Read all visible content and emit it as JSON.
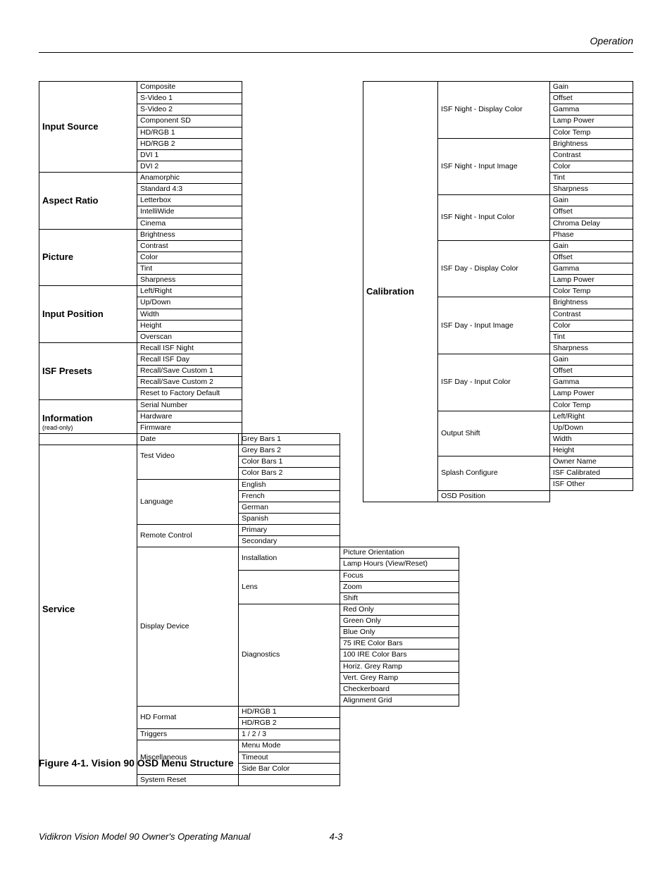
{
  "header": {
    "section": "Operation"
  },
  "left_table": {
    "groups": [
      {
        "title": "Input Source",
        "sub": "",
        "items": [
          "Composite",
          "S-Video 1",
          "S-Video 2",
          "Component SD",
          "HD/RGB 1",
          "HD/RGB 2",
          "DVI 1",
          "DVI 2"
        ]
      },
      {
        "title": "Aspect Ratio",
        "sub": "",
        "items": [
          "Anamorphic",
          "Standard 4:3",
          "Letterbox",
          "IntelliWide",
          "Cinema"
        ]
      },
      {
        "title": "Picture",
        "sub": "",
        "items": [
          "Brightness",
          "Contrast",
          "Color",
          "Tint",
          "Sharpness"
        ]
      },
      {
        "title": "Input Position",
        "sub": "",
        "items": [
          "Left/Right",
          "Up/Down",
          "Width",
          "Height",
          "Overscan"
        ]
      },
      {
        "title": "ISF Presets",
        "sub": "",
        "items": [
          "Recall ISF Night",
          "Recall ISF Day",
          "Recall/Save Custom 1",
          "Recall/Save Custom 2",
          "Reset to Factory Default"
        ]
      },
      {
        "title": "Information",
        "sub": "(read-only)",
        "items": [
          "Serial Number",
          "Hardware",
          "Firmware",
          "Date"
        ]
      }
    ]
  },
  "service_table": {
    "title": "Service",
    "rows": [
      {
        "c2": "Test Video",
        "c2span": 4,
        "c3": "Grey Bars 1"
      },
      {
        "c3": "Grey Bars 2"
      },
      {
        "c3": "Color Bars 1"
      },
      {
        "c3": "Color Bars 2"
      },
      {
        "c2": "Language",
        "c2span": 4,
        "c3": "English"
      },
      {
        "c3": "French"
      },
      {
        "c3": "German"
      },
      {
        "c3": "Spanish"
      },
      {
        "c2": "Remote Control",
        "c2span": 2,
        "c3": "Primary"
      },
      {
        "c3": "Secondary"
      },
      {
        "c2": "Display Device",
        "c2span": 14,
        "c3": "Installation",
        "c3span": 2,
        "c4": "Picture Orientation"
      },
      {
        "c4": "Lamp Hours (View/Reset)"
      },
      {
        "c3": "Lens",
        "c3span": 3,
        "c4": "Focus"
      },
      {
        "c4": "Zoom"
      },
      {
        "c4": "Shift"
      },
      {
        "c3": "Diagnostics",
        "c3span": 9,
        "c4": "Red Only"
      },
      {
        "c4": "Green Only"
      },
      {
        "c4": "Blue Only"
      },
      {
        "c4": "75 IRE Color Bars"
      },
      {
        "c4": "100 IRE Color Bars"
      },
      {
        "c4": "Horiz. Grey Ramp"
      },
      {
        "c4": "Vert. Grey Ramp"
      },
      {
        "c4": "Checkerboard"
      },
      {
        "c4": "Alignment Grid"
      },
      {
        "c2": "HD Format",
        "c2span": 2,
        "c3": "HD/RGB 1"
      },
      {
        "c3": "HD/RGB 2"
      },
      {
        "c2": "Triggers",
        "c3": "1 / 2 / 3"
      },
      {
        "c2": "Miscellaneous",
        "c2span": 3,
        "c3": "Menu Mode"
      },
      {
        "c3": "Timeout"
      },
      {
        "c3": "Side Bar Color"
      },
      {
        "c2": "System Reset",
        "c3": ""
      }
    ]
  },
  "calibration_table": {
    "title": "Calibration",
    "rows": [
      {
        "c2": "ISF Night - Display Color",
        "c2span": 5,
        "c3": "Gain"
      },
      {
        "c3": "Offset"
      },
      {
        "c3": "Gamma"
      },
      {
        "c3": "Lamp Power"
      },
      {
        "c3": "Color Temp"
      },
      {
        "c2": "ISF Night - Input Image",
        "c2span": 5,
        "c3": "Brightness"
      },
      {
        "c3": "Contrast"
      },
      {
        "c3": "Color"
      },
      {
        "c3": "Tint"
      },
      {
        "c3": "Sharpness"
      },
      {
        "c2": "ISF Night - Input Color",
        "c2span": 4,
        "c3": "Gain"
      },
      {
        "c3": "Offset"
      },
      {
        "c3": "Chroma Delay"
      },
      {
        "c3": "Phase"
      },
      {
        "c2": "ISF Day - Display Color",
        "c2span": 5,
        "c3": "Gain"
      },
      {
        "c3": "Offset"
      },
      {
        "c3": "Gamma"
      },
      {
        "c3": "Lamp Power"
      },
      {
        "c3": "Color Temp"
      },
      {
        "c2": "ISF Day - Input Image",
        "c2span": 5,
        "c3": "Brightness"
      },
      {
        "c3": "Contrast"
      },
      {
        "c3": "Color"
      },
      {
        "c3": "Tint"
      },
      {
        "c3": "Sharpness"
      },
      {
        "c2": "ISF Day - Input Color",
        "c2span": 5,
        "c3": "Gain"
      },
      {
        "c3": "Offset"
      },
      {
        "c3": "Gamma"
      },
      {
        "c3": "Lamp Power"
      },
      {
        "c3": "Color Temp"
      },
      {
        "c2": "Output Shift",
        "c2span": 4,
        "c3": "Left/Right"
      },
      {
        "c3": "Up/Down"
      },
      {
        "c3": "Width"
      },
      {
        "c3": "Height"
      },
      {
        "c2": "Splash Configure",
        "c2span": 3,
        "c3": "Owner Name"
      },
      {
        "c3": "ISF Calibrated"
      },
      {
        "c3": "ISF Other"
      },
      {
        "c2": "OSD Position"
      }
    ]
  },
  "figure_caption": "Figure 4-1. Vision 90 OSD Menu Structure",
  "footer": {
    "left": "Vidikron Vision Model 90 Owner's Operating Manual",
    "page": "4-3"
  }
}
